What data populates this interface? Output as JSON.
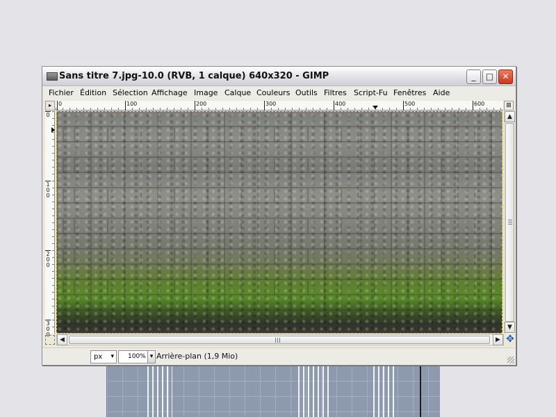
{
  "window": {
    "title": "Sans titre 7.jpg-10.0 (RVB, 1 calque) 640x320 - GIMP",
    "minimize_label": "_",
    "maximize_label": "□",
    "close_label": "✕"
  },
  "menu": {
    "items": [
      {
        "label": "Fichier"
      },
      {
        "label": "Édition"
      },
      {
        "label": "Sélection"
      },
      {
        "label": "Affichage"
      },
      {
        "label": "Image"
      },
      {
        "label": "Calque"
      },
      {
        "label": "Couleurs"
      },
      {
        "label": "Outils"
      },
      {
        "label": "Filtres"
      },
      {
        "label": "Script-Fu"
      },
      {
        "label": "Fenêtres"
      },
      {
        "label": "Aide"
      }
    ]
  },
  "rulers": {
    "horizontal_labels": [
      "0",
      "100",
      "200",
      "300",
      "400",
      "500",
      "600"
    ],
    "vertical_labels": [
      "0",
      "100",
      "200",
      "300"
    ]
  },
  "canvas": {
    "image_description_icon": "stone-wall-image",
    "selection_color": "#d9c100"
  },
  "statusbar": {
    "unit": "px",
    "zoom": "100%",
    "layer_info": "Arrière-plan (1,9 Mio)"
  },
  "icons": {
    "scroll_up": "▲",
    "scroll_down": "▼",
    "scroll_left": "◀",
    "scroll_right": "▶",
    "navigate": "✥",
    "dropdown": "▾",
    "zoom_corner": "⊞",
    "ruler_corner": "▸"
  }
}
